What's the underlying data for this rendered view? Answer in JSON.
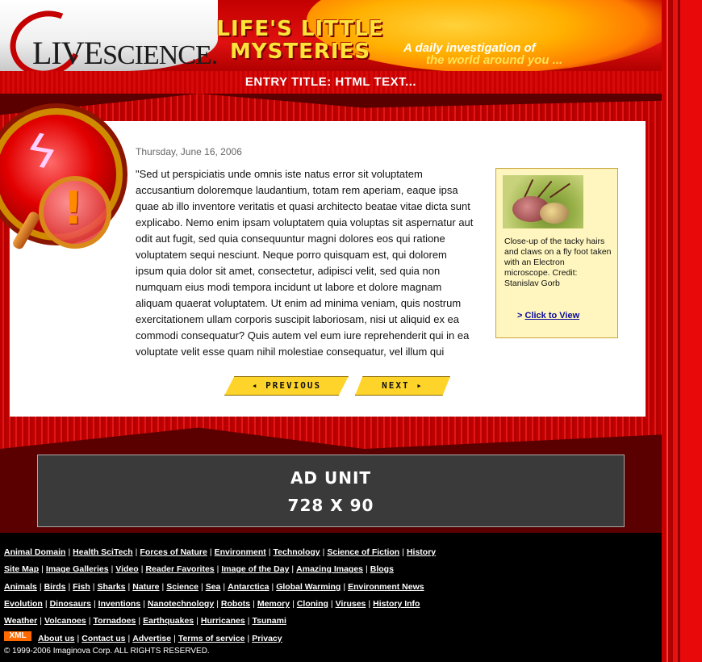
{
  "header": {
    "logo_main": "LIVE",
    "logo_rest": "SCIENCE",
    "logo_tm": ".",
    "section_title_line1": "LIFE'S LITTLE",
    "section_title_line2": "MYSTERIES",
    "tagline_line1": "A daily investigation of",
    "tagline_line2": "the world around you ..."
  },
  "entry": {
    "title": "ENTRY TITLE: HTML TEXT...",
    "date": "Thursday, June 16, 2006",
    "body": "\"Sed ut perspiciatis unde omnis iste natus error sit voluptatem accusantium doloremque laudantium, totam rem aperiam, eaque ipsa quae ab illo inventore veritatis et quasi architecto beatae vitae dicta sunt explicabo. Nemo enim ipsam voluptatem quia voluptas sit aspernatur aut odit aut fugit, sed quia consequuntur magni dolores eos qui ratione voluptatem sequi nesciunt. Neque porro quisquam est, qui dolorem ipsum quia dolor sit amet, consectetur, adipisci velit, sed quia non numquam eius modi tempora incidunt ut labore et dolore magnam aliquam quaerat voluptatem. Ut enim ad minima veniam, quis nostrum exercitationem ullam corporis suscipit laboriosam, nisi ut aliquid ex ea commodi consequatur? Quis autem vel eum iure reprehenderit qui in ea voluptate velit esse quam nihil molestiae consequatur, vel illum qui"
  },
  "sidebar": {
    "caption": "Close-up of the tacky hairs and claws on a fly foot taken with an Electron microscope. Credit: Stanislav Gorb",
    "link_prefix": ">",
    "link_label": "Click to View"
  },
  "nav": {
    "previous_label": "◂ PREVIOUS",
    "next_label": "NEXT ▸"
  },
  "ad": {
    "line1": "AD UNIT",
    "line2": "728 X 90"
  },
  "footer": {
    "rows": [
      [
        "Animal Domain",
        "Health SciTech",
        "Forces of Nature",
        "Environment",
        "Technology",
        "Science of Fiction",
        "History"
      ],
      [
        "Site Map",
        "Image Galleries",
        "Video",
        "Reader Favorites",
        "Image of the Day",
        "Amazing Images",
        "Blogs"
      ],
      [
        "Animals",
        "Birds",
        "Fish",
        "Sharks",
        "Nature",
        "Science",
        "Sea",
        "Antarctica",
        "Global Warming",
        "Environment News"
      ],
      [
        "Evolution",
        "Dinosaurs",
        "Inventions",
        "Nanotechnology",
        "Robots",
        "Memory",
        "Cloning",
        "Viruses",
        "History Info"
      ],
      [
        "Weather",
        "Volcanoes",
        "Tornadoes",
        "Earthquakes",
        "Hurricanes",
        "Tsunami"
      ],
      [
        "About us",
        "Contact us",
        "Advertise",
        "Terms of service",
        "Privacy"
      ]
    ],
    "xml_badge": "XML",
    "copyright": "© 1999-2006 Imaginova Corp. ALL RIGHTS RESERVED."
  }
}
